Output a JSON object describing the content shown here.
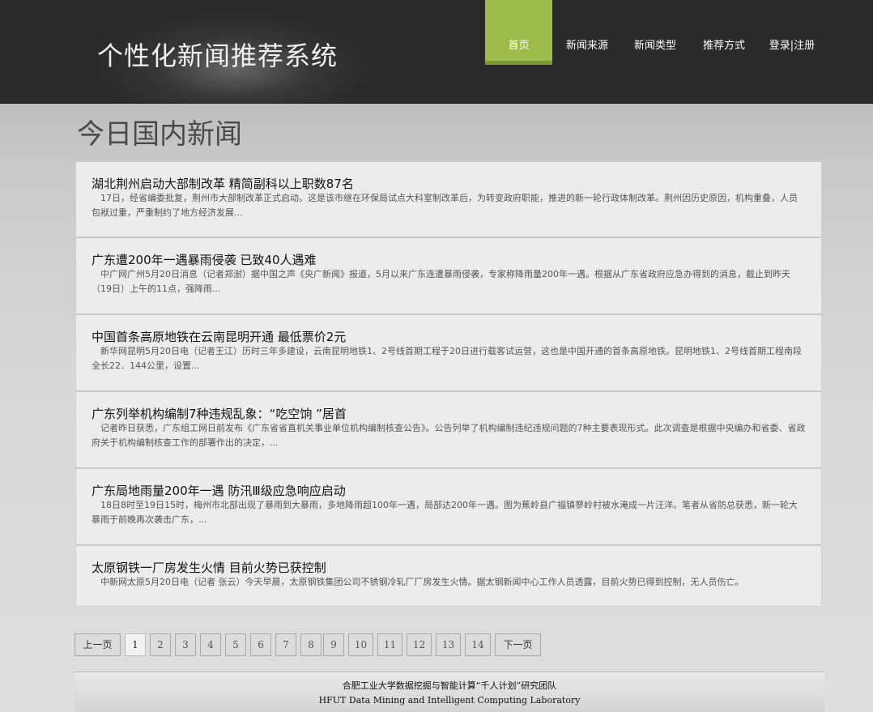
{
  "header": {
    "site_title": "个性化新闻推荐系统",
    "nav": [
      {
        "label": "首页",
        "active": true
      },
      {
        "label": "新闻来源",
        "active": false
      },
      {
        "label": "新闻类型",
        "active": false
      },
      {
        "label": "推荐方式",
        "active": false
      },
      {
        "label": "登录|注册",
        "active": false
      }
    ],
    "accent_color": "#9dbb4b"
  },
  "main": {
    "section_title": "今日国内新闻",
    "news": [
      {
        "title": "湖北荆州启动大部制改革  精简副科以上职数87名",
        "summary": "17日，经省编委批复，荆州市大部制改革正式启动。这是该市继在环保局试点大科室制改革后，为转变政府职能，推进的新一轮行政体制改革。荆州因历史原因，机构重叠，人员包袱过重，严重制约了地方经济发展..."
      },
      {
        "title": "广东遭200年一遇暴雨侵袭  已致40人遇难",
        "summary": "中广网广州5月20日消息（记者郑澍）据中国之声《央广新闻》报道，5月以来广东连遭暴雨侵袭，专家称降雨量200年一遇。根据从广东省政府应急办得到的消息，截止到昨天（19日）上午的11点，强降雨..."
      },
      {
        "title": "中国首条高原地铁在云南昆明开通  最低票价2元",
        "summary": "新华网昆明5月20日电（记者王江）历时三年多建设，云南昆明地铁1、2号线首期工程于20日进行载客试运营，这也是中国开通的首条高原地铁。昆明地铁1、2号线首期工程南段全长22．144公里，设置..."
      },
      {
        "title": "广东列举机构编制7种违规乱象：“吃空饷 ”居首",
        "summary": "记者昨日获悉，广东组工网日前发布《广东省省直机关事业单位机构编制核查公告》。公告列举了机构编制违纪违规问题的7种主要表现形式。此次调查是根据中央编办和省委、省政府关于机构编制核查工作的部署作出的决定，..."
      },
      {
        "title": "广东局地雨量200年一遇  防汛Ⅲ级应急响应启动",
        "summary": "18日8时至19日15时，梅州市北部出现了暴雨到大暴雨，多地降雨超100年一遇，局部达200年一遇。图为蕉岭县广福镇蓼岭村被水淹成一片汪洋。笔者从省防总获悉，新一轮大暴雨于前晚再次袭击广东，..."
      },
      {
        "title": "太原钢铁一厂房发生火情  目前火势已获控制",
        "summary": "中新网太原5月20日电（记者  张云）今天早晨，太原钢铁集团公司不锈钢冷轧厂厂房发生火情。据太钢新闻中心工作人员透露，目前火势已得到控制，无人员伤亡。"
      }
    ]
  },
  "pagination": {
    "prev_label": "上一页",
    "next_label": "下一页",
    "pages": [
      "1",
      "2",
      "3",
      "4",
      "5",
      "6",
      "7",
      "8",
      "9",
      "10",
      "11",
      "12",
      "13",
      "14"
    ],
    "current": "1"
  },
  "footer": {
    "line1": "合肥工业大学数据挖掘与智能计算“千人计划”研究团队",
    "line2": "HFUT Data Mining and Intelligent Computing Laboratory"
  }
}
